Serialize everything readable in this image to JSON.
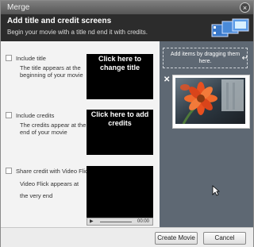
{
  "window": {
    "title": "Merge",
    "close_glyph": "×"
  },
  "header": {
    "title": "Add title and credit screens",
    "subtitle": "Begin your movie with a title nd end it with credits.",
    "icon": "film-stack-icon"
  },
  "options": [
    {
      "label": "Include title",
      "description": "The title appears at the beginning of your movie",
      "checked": false,
      "preview_text": "Click here to change title"
    },
    {
      "label": "Include credits",
      "description": "The credits appear at the end of your movie",
      "checked": false,
      "preview_text": "Click here to add credits"
    },
    {
      "label": "Share credit with Video Flick",
      "description": "Video Flick appears at the very end",
      "checked": false
    }
  ],
  "player": {
    "play_glyph": "▶",
    "time": "00:00"
  },
  "right_panel": {
    "drop_hint": "Add items by dragging them here.",
    "remove_glyph": "✕",
    "thumbnail": "flower-photo"
  },
  "footer": {
    "create_label": "Create Movie",
    "cancel_label": "Cancel"
  },
  "colors": {
    "header_bg": "#2c2c2c",
    "panel_bg": "#5e6873",
    "flower": "#e8501f"
  }
}
